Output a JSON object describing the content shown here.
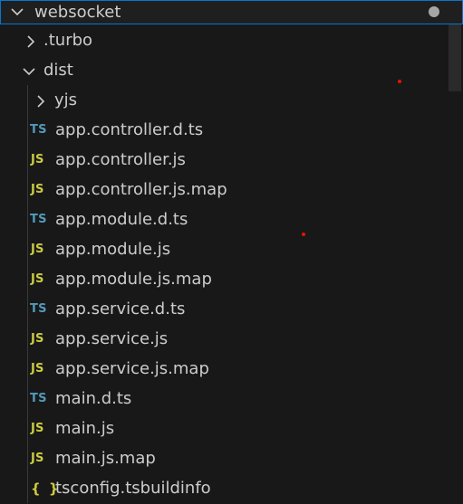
{
  "explorer": {
    "root": {
      "label": "websocket",
      "chevron": "chevron-down-icon",
      "modified_indicator": "dot-icon"
    },
    "items": [
      {
        "label": ".turbo",
        "kind": "folder",
        "expanded": false,
        "icon": "chevron-right-icon"
      },
      {
        "label": "dist",
        "kind": "folder",
        "expanded": true,
        "icon": "chevron-down-icon"
      },
      {
        "label": "yjs",
        "kind": "folder",
        "expanded": false,
        "icon": "chevron-right-icon"
      },
      {
        "label": "app.controller.d.ts",
        "kind": "file",
        "badge": "TS"
      },
      {
        "label": "app.controller.js",
        "kind": "file",
        "badge": "JS"
      },
      {
        "label": "app.controller.js.map",
        "kind": "file",
        "badge": "JS"
      },
      {
        "label": "app.module.d.ts",
        "kind": "file",
        "badge": "TS"
      },
      {
        "label": "app.module.js",
        "kind": "file",
        "badge": "JS"
      },
      {
        "label": "app.module.js.map",
        "kind": "file",
        "badge": "JS"
      },
      {
        "label": "app.service.d.ts",
        "kind": "file",
        "badge": "TS"
      },
      {
        "label": "app.service.js",
        "kind": "file",
        "badge": "JS"
      },
      {
        "label": "app.service.js.map",
        "kind": "file",
        "badge": "JS"
      },
      {
        "label": "main.d.ts",
        "kind": "file",
        "badge": "TS"
      },
      {
        "label": "main.js",
        "kind": "file",
        "badge": "JS"
      },
      {
        "label": "main.js.map",
        "kind": "file",
        "badge": "JS"
      },
      {
        "label": "tsconfig.tsbuildinfo",
        "kind": "file",
        "badge": "{ }"
      }
    ]
  },
  "colors": {
    "background": "#181818",
    "focus_border": "#0078d4",
    "text": "#cccccc",
    "ts_badge": "#519aba",
    "js_badge": "#cbcb41",
    "json_badge": "#cbcb41"
  }
}
